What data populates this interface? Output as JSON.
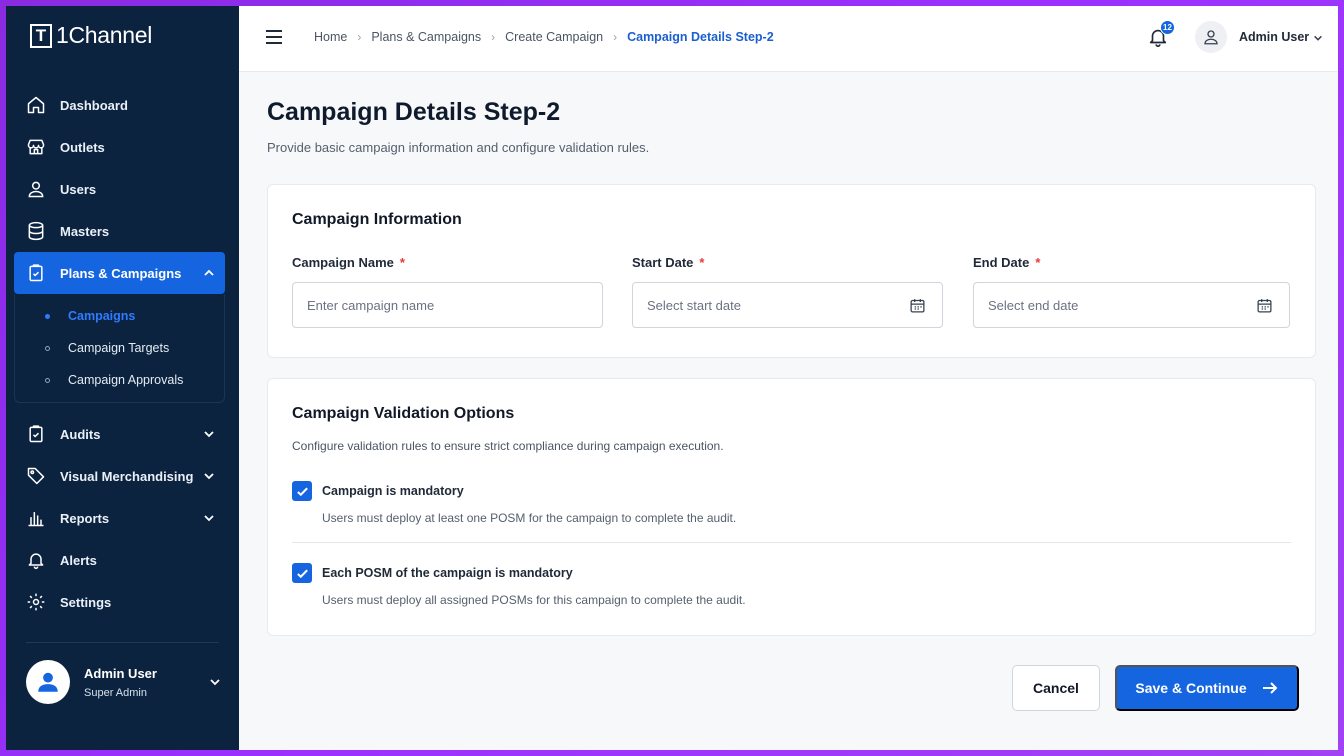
{
  "app": {
    "name": "1Channel",
    "logo_letter": "T"
  },
  "sidebar": {
    "items": [
      {
        "label": "Dashboard",
        "icon": "home-icon"
      },
      {
        "label": "Outlets",
        "icon": "store-icon"
      },
      {
        "label": "Users",
        "icon": "user-icon"
      },
      {
        "label": "Masters",
        "icon": "database-icon"
      },
      {
        "label": "Plans & Campaigns",
        "icon": "clipboard-check-icon",
        "expanded": true
      },
      {
        "label": "Audits",
        "icon": "clipboard-icon"
      },
      {
        "label": "Visual Merchandising",
        "icon": "tag-icon"
      },
      {
        "label": "Reports",
        "icon": "bar-chart-icon"
      },
      {
        "label": "Alerts",
        "icon": "bell-icon"
      },
      {
        "label": "Settings",
        "icon": "gear-icon"
      }
    ],
    "subitems": [
      {
        "label": "Campaigns",
        "active": true
      },
      {
        "label": "Campaign Targets"
      },
      {
        "label": "Campaign Approvals"
      }
    ],
    "profile": {
      "name": "Admin User",
      "role": "Super Admin"
    }
  },
  "topbar": {
    "breadcrumb": [
      "Home",
      "Plans & Campaigns",
      "Create Campaign",
      "Campaign Details Step-2"
    ],
    "notification_count": "12",
    "user_name": "Admin User"
  },
  "page": {
    "title": "Campaign Details Step-2",
    "subtitle": "Provide basic campaign information and configure validation rules."
  },
  "campaign_info": {
    "title": "Campaign Information",
    "fields": [
      {
        "label": "Campaign Name",
        "required": "*",
        "placeholder": "Enter campaign name"
      },
      {
        "label": "Start Date",
        "required": "*",
        "placeholder": "Select start date"
      },
      {
        "label": "End Date",
        "required": "*",
        "placeholder": "Select end date"
      }
    ]
  },
  "validation": {
    "title": "Campaign Validation Options",
    "description": "Configure validation rules to ensure strict compliance during campaign execution.",
    "options": [
      {
        "title": "Campaign is mandatory",
        "description": "Users must deploy at least one POSM for the campaign to complete the audit.",
        "checked": true
      },
      {
        "title": "Each POSM of the campaign is mandatory",
        "description": "Users must deploy all assigned POSMs for this campaign to complete the audit.",
        "checked": true
      }
    ]
  },
  "actions": {
    "cancel": "Cancel",
    "save": "Save & Continue"
  },
  "colors": {
    "sidebar_bg": "#0c2340",
    "accent": "#1565e0",
    "required": "#e23b3b"
  }
}
